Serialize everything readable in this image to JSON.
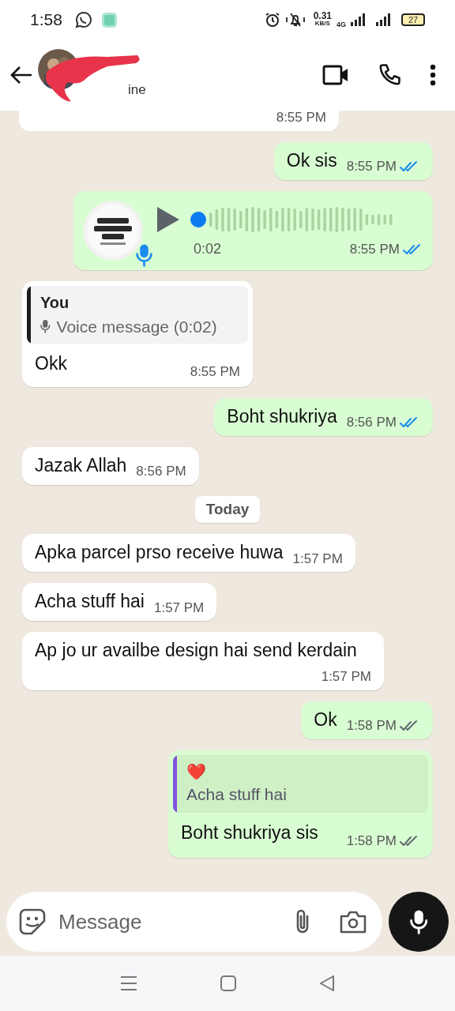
{
  "status_bar": {
    "time": "1:58",
    "speed": "0.31",
    "speed_unit": "KB/S",
    "network": "4G",
    "battery": "27"
  },
  "header": {
    "status": "ine"
  },
  "messages": [
    {
      "kind": "stub",
      "outgoing": false,
      "time": "8:55 PM"
    },
    {
      "kind": "text",
      "outgoing": true,
      "text": "Ok sis",
      "time": "8:55 PM",
      "read": true
    },
    {
      "kind": "voice",
      "outgoing": true,
      "duration": "0:02",
      "time": "8:55 PM",
      "read": true
    },
    {
      "kind": "quote",
      "outgoing": false,
      "quote_author": "You",
      "quote_text": "Voice message (0:02)",
      "text": "Okk",
      "time": "8:55 PM"
    },
    {
      "kind": "text",
      "outgoing": true,
      "text": "Boht shukriya",
      "time": "8:56 PM",
      "read": true
    },
    {
      "kind": "text",
      "outgoing": false,
      "text": "Jazak Allah",
      "time": "8:56 PM"
    },
    {
      "kind": "date",
      "text": "Today"
    },
    {
      "kind": "text",
      "outgoing": false,
      "text": "Apka parcel prso receive huwa",
      "time": "1:57 PM"
    },
    {
      "kind": "text",
      "outgoing": false,
      "text": "Acha stuff hai",
      "time": "1:57 PM"
    },
    {
      "kind": "text",
      "outgoing": false,
      "text": "Ap jo ur availbe design hai send kerdain",
      "time": "1:57 PM"
    },
    {
      "kind": "text",
      "outgoing": true,
      "text": "Ok",
      "time": "1:58 PM",
      "read": false
    },
    {
      "kind": "reply",
      "outgoing": true,
      "quote_emoji": "❤️",
      "quote_text": "Acha stuff hai",
      "text": "Boht shukriya sis",
      "time": "1:58 PM",
      "read": false
    }
  ],
  "composer": {
    "placeholder": "Message"
  }
}
